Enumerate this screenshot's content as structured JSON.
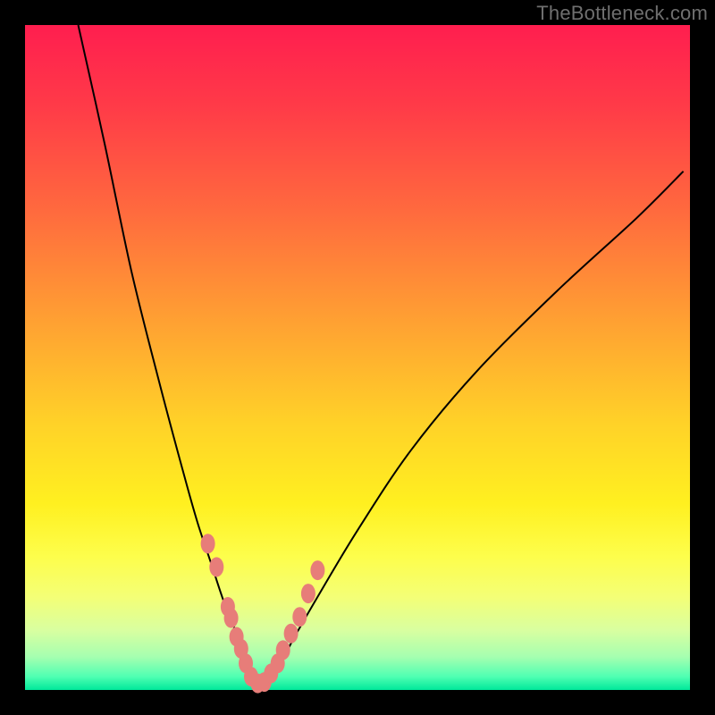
{
  "watermark": "TheBottleneck.com",
  "chart_data": {
    "type": "line",
    "title": "",
    "xlabel": "",
    "ylabel": "",
    "xlim": [
      0,
      100
    ],
    "ylim": [
      0,
      100
    ],
    "series": [
      {
        "name": "bottleneck-curve",
        "x": [
          8,
          12,
          16,
          20,
          24,
          26,
          28,
          30,
          32,
          33,
          34,
          35,
          36,
          38,
          40,
          44,
          50,
          58,
          68,
          80,
          92,
          99
        ],
        "y": [
          100,
          82,
          63,
          47,
          32,
          25,
          19,
          13,
          8,
          5,
          3,
          1,
          1,
          3,
          7,
          14,
          24,
          36,
          48,
          60,
          71,
          78
        ]
      }
    ],
    "markers": {
      "name": "highlight-dots",
      "x": [
        27.5,
        28.8,
        30.5,
        31.0,
        31.8,
        32.5,
        33.2,
        34.0,
        35.0,
        36.0,
        37.0,
        38.0,
        38.8,
        40.0,
        41.3,
        42.6,
        44.0
      ],
      "y": [
        22.0,
        18.5,
        12.5,
        10.8,
        8.0,
        6.2,
        4.0,
        2.0,
        1.0,
        1.2,
        2.5,
        4.0,
        6.0,
        8.5,
        11.0,
        14.5,
        18.0
      ]
    },
    "background_gradient": {
      "stops": [
        {
          "pos": 0.0,
          "color": "#ff1e4f"
        },
        {
          "pos": 0.28,
          "color": "#ff6a3e"
        },
        {
          "pos": 0.6,
          "color": "#ffd228"
        },
        {
          "pos": 0.8,
          "color": "#fdfe4c"
        },
        {
          "pos": 0.95,
          "color": "#a6ffb0"
        },
        {
          "pos": 1.0,
          "color": "#00e89a"
        }
      ]
    }
  }
}
